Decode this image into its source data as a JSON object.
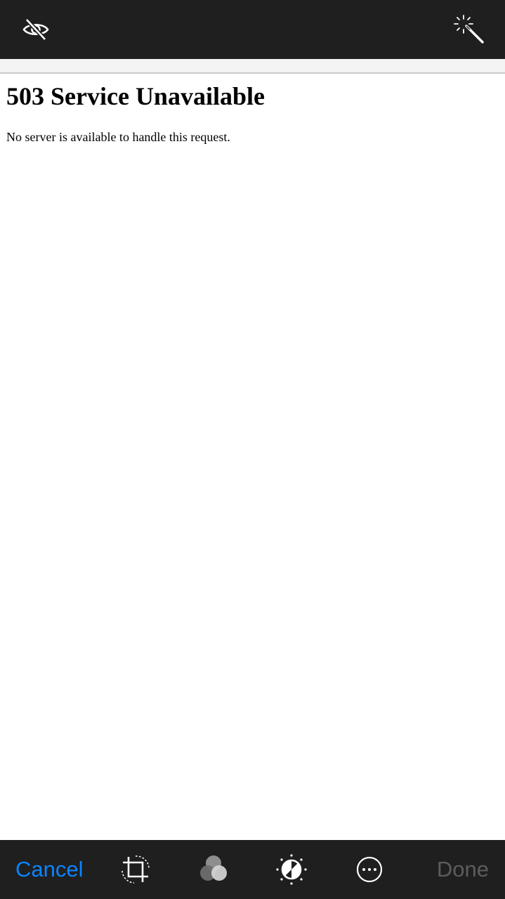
{
  "toolbar_top": {
    "hide_icon": "eye-slash-icon",
    "enhance_icon": "magic-wand-icon"
  },
  "photo": {
    "heading": "503 Service Unavailable",
    "body": "No server is available to handle this request."
  },
  "toolbar_bottom": {
    "cancel_label": "Cancel",
    "done_label": "Done",
    "tools": [
      "crop-rotate-icon",
      "filters-icon",
      "adjust-icon",
      "more-options-icon"
    ]
  },
  "colors": {
    "bar_background": "#1f1f1f",
    "accent": "#0a84ff",
    "disabled": "#5c5c5c"
  }
}
